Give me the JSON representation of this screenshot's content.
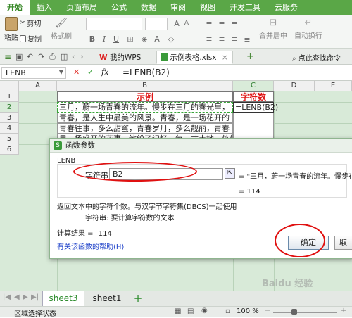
{
  "ribbon": {
    "tabs": [
      "开始",
      "插入",
      "页面布局",
      "公式",
      "数据",
      "审阅",
      "视图",
      "开发工具",
      "云服务"
    ],
    "active_tab": "开始",
    "paste_label": "粘贴",
    "cut_label": "剪切",
    "copy_label": "复制",
    "format_painter_label": "格式刷",
    "merge_center_label": "合并居中",
    "wrap_label": "自动换行"
  },
  "doc_tabs": {
    "tabs": [
      {
        "label": "我的WPS"
      },
      {
        "label": "示例表格.xlsx"
      }
    ],
    "search_label": "点此查找命令"
  },
  "formula_bar": {
    "name_box": "LENB",
    "fx": "fx",
    "formula": "=LENB(B2)"
  },
  "columns": [
    "A",
    "B",
    "C",
    "D",
    "E"
  ],
  "rows": [
    "1",
    "2",
    "3",
    "4",
    "5",
    "6"
  ],
  "cells": {
    "b1": "示例",
    "c1": "字符数",
    "b2": "三月，蔚一场青春的流年。慢步在三月的春光里，",
    "c2": "=LENB(B2)",
    "b3": "青春，是人生中最美的风景。青春，是一场花开的",
    "b4": "青春往事，多么甜蜜，青春岁月，多么靓丽，青春",
    "b5": "是一场盛开的花事，缤纷了记忆，每一寸土地，处处"
  },
  "dialog": {
    "title": "函数参数",
    "func_name": "LENB",
    "arg_label": "字符串",
    "arg_value": "B2",
    "arg_preview": "= \"三月，蔚一场青春的流年。慢步在三月",
    "result_preview": "= 114",
    "desc": "返回文本中的字符个数。与双字节字符集(DBCS)一起使用",
    "arg_desc_label": "字符串:",
    "arg_desc": "要计算字符数的文本",
    "calc_result_label": "计算结果 =",
    "calc_result_value": "114",
    "help_link": "有关该函数的帮助(H)",
    "ok_label": "确定",
    "cancel_label": "取"
  },
  "sheet_tabs": [
    "sheet3",
    "sheet1"
  ],
  "active_sheet": "sheet3",
  "add_sheet": "+",
  "status": {
    "mode": "区域选择状态",
    "zoom": "100 %"
  },
  "watermark": "Baidu 经验"
}
